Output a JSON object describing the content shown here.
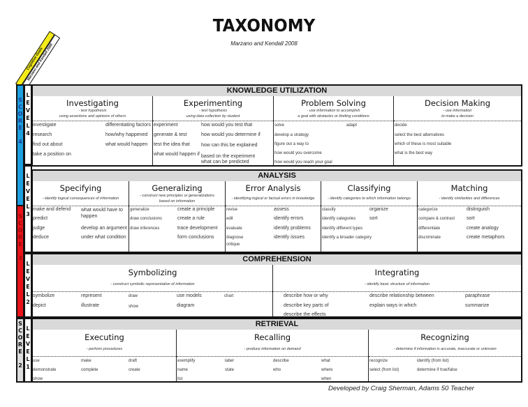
{
  "header": {
    "title": "TAXONOMY",
    "subtitle": "Marzano and Kendall 2008"
  },
  "diagonal_tabs": {
    "yellow": "Cognitive Goals",
    "white": "Marzano and Kendall 2008"
  },
  "score_labels": {
    "score4": [
      "S",
      "C",
      "O",
      "R",
      "E",
      "",
      "4"
    ],
    "score3": [
      "S",
      "C",
      "O",
      "R",
      "E",
      "",
      "3"
    ],
    "score2": [
      "S",
      "C",
      "O",
      "R",
      "E",
      "",
      "2"
    ]
  },
  "level_labels": {
    "level4": [
      "L",
      "E",
      "V",
      "E",
      "L",
      "4"
    ],
    "level3": [
      "L",
      "E",
      "V",
      "E",
      "L",
      "3"
    ],
    "level2": [
      "L",
      "E",
      "V",
      "E",
      "L",
      "2"
    ],
    "level1": [
      "L",
      "E",
      "V",
      "E",
      "L",
      "1"
    ]
  },
  "colors": {
    "score4": "#1e9fe0",
    "score3": "#e8141a",
    "score2": "#dddddd",
    "tab_yellow": "#f4ec1a",
    "band_header": "#d9d9d9"
  },
  "bands": [
    {
      "title": "KNOWLEDGE UTILIZATION",
      "level": "4",
      "categories": [
        {
          "name": "Investigating",
          "desc": [
            "- test hypothesis",
            "using assertions and opinions of others"
          ],
          "terms": [
            "investigate",
            "research",
            "find out about",
            "take a position on",
            "differentiating factors",
            "how/why  happened",
            "what would happen"
          ]
        },
        {
          "name": "Experimenting",
          "desc": [
            "- test hypothesis",
            "using data collection by student"
          ],
          "terms": [
            "experiment",
            "generate & test",
            "test the idea that",
            "what would happen if",
            "how would you test that",
            "how would you determine if",
            "how can this be explained",
            "based on the experiment",
            "what can be predicted"
          ]
        },
        {
          "name": "Problem Solving",
          "desc": [
            "- use information  to accomplish",
            "a goal with obstacles or limiting conditions"
          ],
          "terms": [
            "solve",
            "develop a strategy",
            "figure out a way to",
            "how would you overcome",
            "how would you reach your goal",
            "adapt"
          ]
        },
        {
          "name": "Decision Making",
          "desc": [
            "- use information",
            "to make a decision"
          ],
          "terms": [
            "decide",
            "select the best alternatives",
            "which of these is most suitable",
            "what is the best way"
          ]
        }
      ]
    },
    {
      "title": "ANALYSIS",
      "level": "3",
      "categories": [
        {
          "name": "Specifying",
          "desc": [
            "- identify logical consequences of information"
          ],
          "terms": [
            "make and defend",
            "predict",
            "judge",
            "deduce",
            "what would have to",
            "happen",
            "develop an argument",
            "under what condition"
          ]
        },
        {
          "name": "Generalizing",
          "desc": [
            "- construct new principles or generalizations",
            "based on information"
          ],
          "terms": [
            "generalize",
            "draw conclusions",
            "draw inferences",
            "create a principle",
            "create a rule",
            "trace development",
            "form conclusions"
          ]
        },
        {
          "name": "Error Analysis",
          "desc": [
            "- identifying logical or factual errors in knowledge"
          ],
          "terms": [
            "revise",
            "edit",
            "evaluate",
            "diagnose",
            "critique",
            "assess",
            "identify errors",
            "identify problems",
            "identify issues"
          ]
        },
        {
          "name": "Classifying",
          "desc": [
            "- identify categories to which information belongs"
          ],
          "terms": [
            "classify",
            "identify categories",
            "identify different types",
            "identify a broader category",
            "organize",
            "sort"
          ]
        },
        {
          "name": "Matching",
          "desc": [
            "- identify similarities and differences"
          ],
          "terms": [
            "categorize",
            "compare & contrast",
            "differentiate",
            "discriminate",
            "distinguish",
            "sort",
            "create analogy",
            "create metaphors"
          ]
        }
      ]
    },
    {
      "title": "COMPREHENSION",
      "level": "2",
      "categories": [
        {
          "name": "Symbolizing",
          "desc": [
            "- construct symbolic  representation of information"
          ],
          "terms": [
            "symbolize",
            "depict",
            "represent",
            "illustrate",
            "draw",
            "show",
            "use models",
            "diagram",
            "chart"
          ]
        },
        {
          "name": "Integrating",
          "desc": [
            "- identify basic structure of information"
          ],
          "terms": [
            "describe how or why",
            "describe key parts of",
            "describe the effects",
            "describe relationship between",
            "explain ways in which",
            "paraphrase",
            "summarize"
          ]
        }
      ]
    },
    {
      "title": "RETRIEVAL",
      "level": "1",
      "categories": [
        {
          "name": "Executing",
          "desc": [
            "- perform procedures"
          ],
          "terms": [
            "use",
            "demonstrate",
            "show",
            "make",
            "complete",
            "draft",
            "create"
          ]
        },
        {
          "name": "Recalling",
          "desc": [
            "- produce information on demand"
          ],
          "terms": [
            "exemplify",
            "name",
            "list",
            "label",
            "state",
            "describe",
            "who",
            "what",
            "where",
            "when"
          ]
        },
        {
          "name": "Recognizing",
          "desc": [
            "- determine if information is accurate, inaccurate or unknown"
          ],
          "terms": [
            "recognize",
            "select (from list)",
            "identify (from list)",
            "determine if true/false"
          ]
        }
      ]
    }
  ],
  "footer": "Developed by Craig Sherman, Adams 50 Teacher"
}
